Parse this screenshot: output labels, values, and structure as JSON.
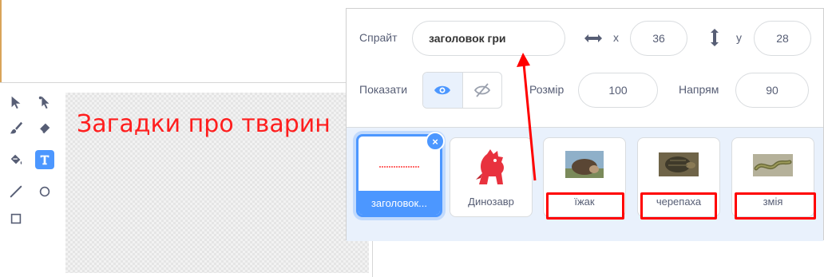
{
  "paint_editor": {
    "tools": [
      {
        "name": "select",
        "icon": "arrow-select-icon"
      },
      {
        "name": "reshape",
        "icon": "reshape-icon"
      },
      {
        "name": "brush",
        "icon": "brush-icon"
      },
      {
        "name": "eraser",
        "icon": "eraser-icon"
      },
      {
        "name": "fill",
        "icon": "fill-icon"
      },
      {
        "name": "text",
        "icon": "text-icon",
        "active": true
      },
      {
        "name": "line",
        "icon": "line-icon"
      },
      {
        "name": "circle",
        "icon": "circle-icon"
      },
      {
        "name": "rectangle",
        "icon": "rectangle-icon"
      }
    ],
    "canvas_text": "Загадки про тварин",
    "canvas_text_color": "#ff1e1e"
  },
  "sprite_info": {
    "sprite_label": "Спрайт",
    "sprite_name": "заголовок гри",
    "x_label": "x",
    "x_value": "36",
    "y_label": "y",
    "y_value": "28",
    "show_label": "Показати",
    "size_label": "Розмір",
    "size_value": "100",
    "direction_label": "Напрям",
    "direction_value": "90"
  },
  "sprites": [
    {
      "name": "заголовок...",
      "selected": true,
      "thumb": "title-thumbnail"
    },
    {
      "name": "Динозавр",
      "selected": false,
      "thumb": "dinosaur-thumbnail"
    },
    {
      "name": "їжак",
      "selected": false,
      "thumb": "hedgehog-thumbnail",
      "highlighted": true
    },
    {
      "name": "черепаха",
      "selected": false,
      "thumb": "turtle-thumbnail",
      "highlighted": true
    },
    {
      "name": "змія",
      "selected": false,
      "thumb": "snake-thumbnail",
      "highlighted": true
    }
  ],
  "colors": {
    "accent": "#4c97ff",
    "annotation": "#ff0000",
    "sprite_list_bg": "#e9f1fc"
  }
}
